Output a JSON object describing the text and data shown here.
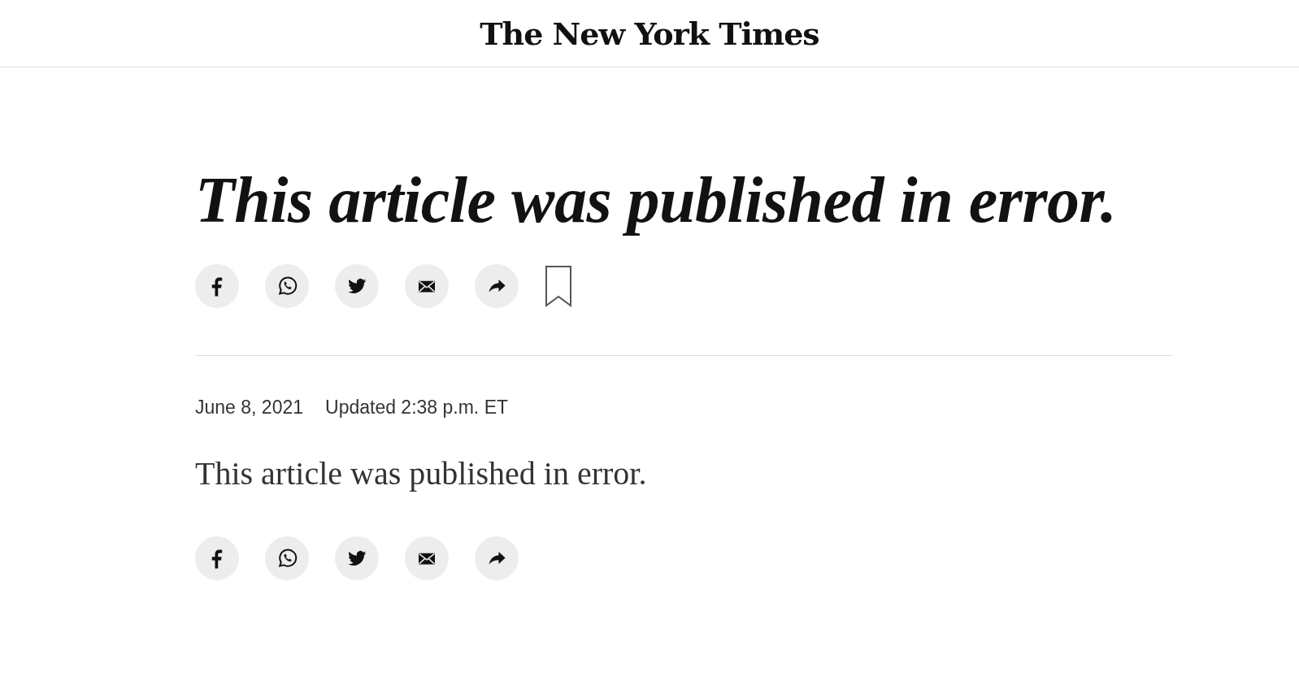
{
  "masthead": {
    "logo": "The New York Times"
  },
  "headline": "This article was published in error.",
  "top_share": [
    {
      "kind": "facebook"
    },
    {
      "kind": "whatsapp"
    },
    {
      "kind": "twitter"
    },
    {
      "kind": "email"
    },
    {
      "kind": "share"
    },
    {
      "kind": "bookmark"
    }
  ],
  "dateline": {
    "date": "June 8, 2021",
    "updated": "Updated 2:38 p.m. ET"
  },
  "body": "This article was published in error.",
  "bottom_share": [
    {
      "kind": "facebook"
    },
    {
      "kind": "whatsapp"
    },
    {
      "kind": "twitter"
    },
    {
      "kind": "email"
    },
    {
      "kind": "share"
    }
  ]
}
